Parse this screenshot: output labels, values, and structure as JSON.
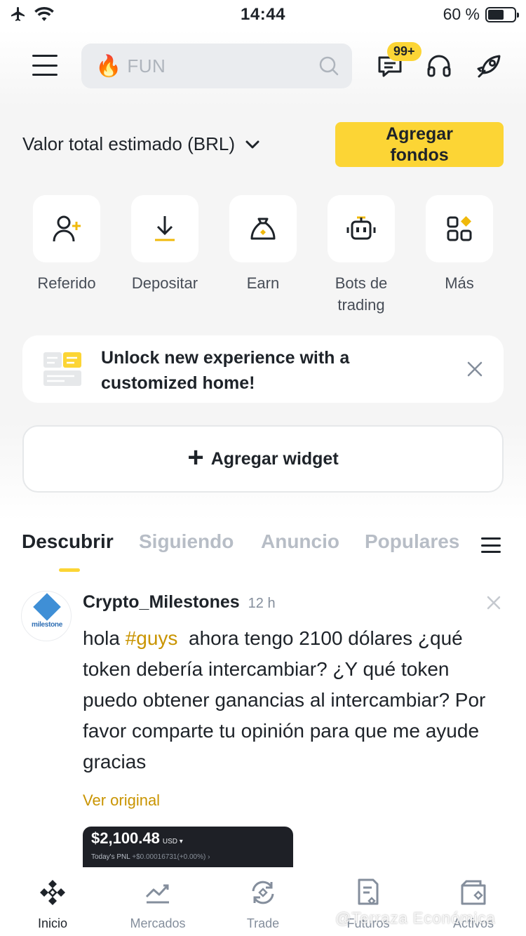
{
  "status_bar": {
    "time": "14:44",
    "battery_text": "60 %",
    "battery_level": 0.6
  },
  "header": {
    "search_placeholder": "FUN",
    "messages_badge": "99+"
  },
  "balance": {
    "label": "Valor total estimado (BRL)",
    "add_funds": "Agregar fondos"
  },
  "quick_actions": [
    {
      "label": "Referido",
      "icon": "referral-icon"
    },
    {
      "label": "Depositar",
      "icon": "deposit-icon"
    },
    {
      "label": "Earn",
      "icon": "earn-bag-icon"
    },
    {
      "label": "Bots de trading",
      "icon": "robot-icon"
    },
    {
      "label": "Más",
      "icon": "more-grid-icon"
    }
  ],
  "unlock_banner": {
    "text": "Unlock new experience with a customized home!"
  },
  "widget": {
    "add_label": "Agregar widget"
  },
  "feed_tabs": [
    "Descubrir",
    "Siguiendo",
    "Anuncio",
    "Populares"
  ],
  "post": {
    "author": "Crypto_Milestones",
    "time": "12 h",
    "avatar_text": "milestone",
    "body_before": "hola ",
    "hashtag": "#guys",
    "body_after": "  ahora tengo 2100 dólares ¿qué token debería intercambiar? ¿Y qué token puedo obtener ganancias al intercambiar? Por favor comparte tu opinión para que me ayude gracias",
    "translate_link": "Ver original",
    "image": {
      "balance": "$2,100.48",
      "currency": "USD ▾",
      "pnl_label": "Today's PNL",
      "pnl_value": "+$0.00016731(+0.00%)"
    }
  },
  "bottom_nav": [
    {
      "label": "Inicio",
      "icon": "binance-logo-icon",
      "active": true
    },
    {
      "label": "Mercados",
      "icon": "markets-chart-icon",
      "active": false
    },
    {
      "label": "Trade",
      "icon": "trade-swap-icon",
      "active": false
    },
    {
      "label": "Futuros",
      "icon": "futures-doc-icon",
      "active": false
    },
    {
      "label": "Activos",
      "icon": "wallet-icon",
      "active": false
    }
  ],
  "watermark": "@Terraza Económica",
  "colors": {
    "accent": "#fcd535",
    "hashtag": "#c99400",
    "text_primary": "#1e2329",
    "text_secondary": "#848e9c"
  }
}
